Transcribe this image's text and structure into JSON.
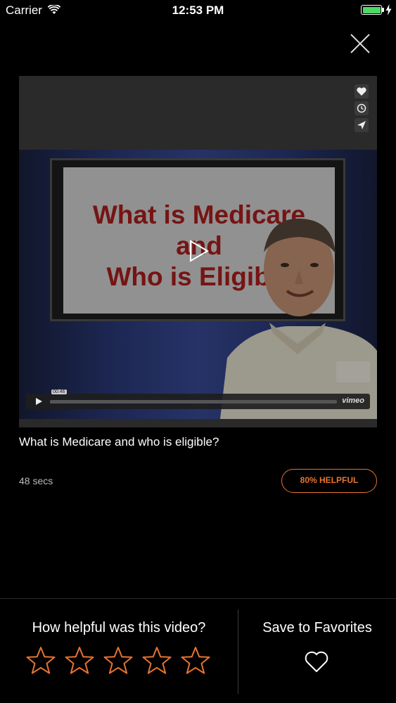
{
  "status_bar": {
    "carrier": "Carrier",
    "time": "12:53 PM"
  },
  "video": {
    "slide_lines": [
      "What is Medicare",
      "and",
      "Who is Eligible"
    ],
    "timestamp": "00:46",
    "player_brand": "vimeo",
    "title": "What is Medicare and who is eligible?",
    "duration": "48 secs",
    "helpful_label": "80% HELPFUL"
  },
  "rating": {
    "prompt": "How helpful was this video?",
    "stars": [
      {
        "name": "star-1",
        "filled": false
      },
      {
        "name": "star-2",
        "filled": false
      },
      {
        "name": "star-3",
        "filled": false
      },
      {
        "name": "star-4",
        "filled": false
      },
      {
        "name": "star-5",
        "filled": false
      }
    ]
  },
  "favorites": {
    "label": "Save to Favorites"
  },
  "colors": {
    "accent": "#e87430",
    "battery": "#4cd964",
    "background": "#000000"
  },
  "icons": [
    "wifi-icon",
    "battery-icon",
    "charging-icon",
    "close-icon",
    "heart-icon",
    "clock-icon",
    "send-icon",
    "play-icon",
    "star-icon"
  ]
}
